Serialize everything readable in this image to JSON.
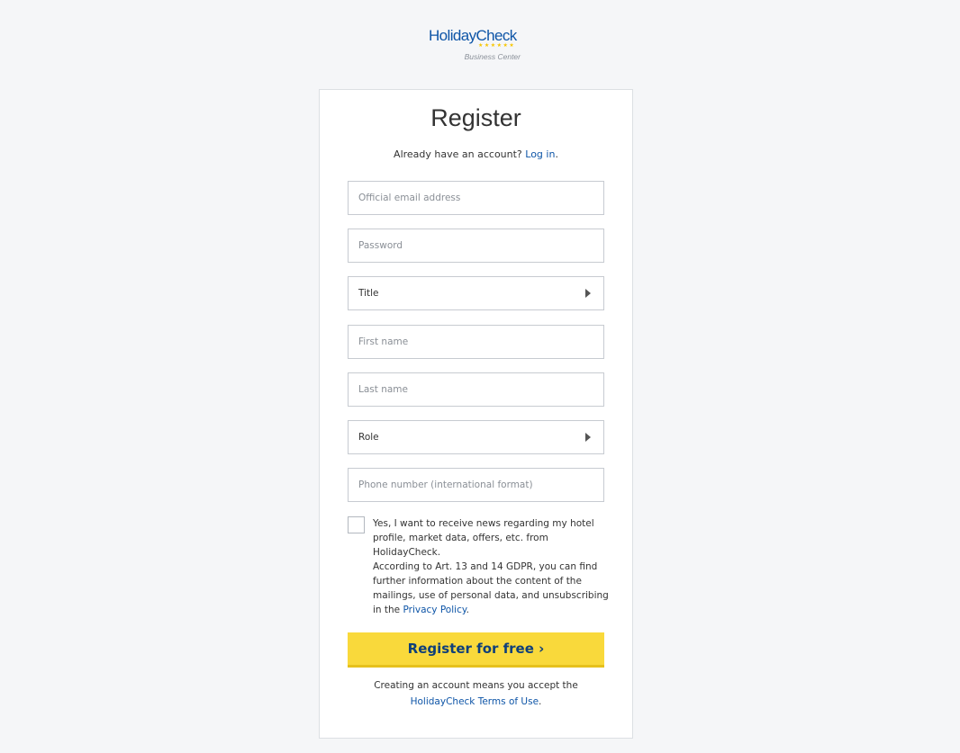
{
  "brand": {
    "name": "HolidayCheck",
    "stars": "★★★★★★",
    "subtitle": "Business Center"
  },
  "form": {
    "title": "Register",
    "login_prompt": "Already have an account?",
    "login_link": "Log in",
    "login_suffix": ".",
    "email_placeholder": "Official email address",
    "password_placeholder": "Password",
    "title_select": "Title",
    "first_name_placeholder": "First name",
    "last_name_placeholder": "Last name",
    "role_select": "Role",
    "phone_placeholder": "Phone number (international format)",
    "newsletter_label": "Yes, I want to receive news regarding my hotel profile, market data, offers, etc. from HolidayCheck.",
    "gdpr_text": "According to Art. 13 and 14 GDPR, you can find further information about the content of the mailings, use of personal data, and unsubscribing in the",
    "privacy_link": "Privacy Policy",
    "gdpr_suffix": ".",
    "submit_label": "Register for free",
    "submit_icon": "›",
    "terms_prefix": "Creating an account means you accept the",
    "terms_link": "HolidayCheck Terms of Use",
    "terms_suffix": "."
  },
  "colors": {
    "brand_blue": "#0e55a7",
    "button_yellow": "#f9d93b",
    "star_yellow": "#f7c600"
  }
}
